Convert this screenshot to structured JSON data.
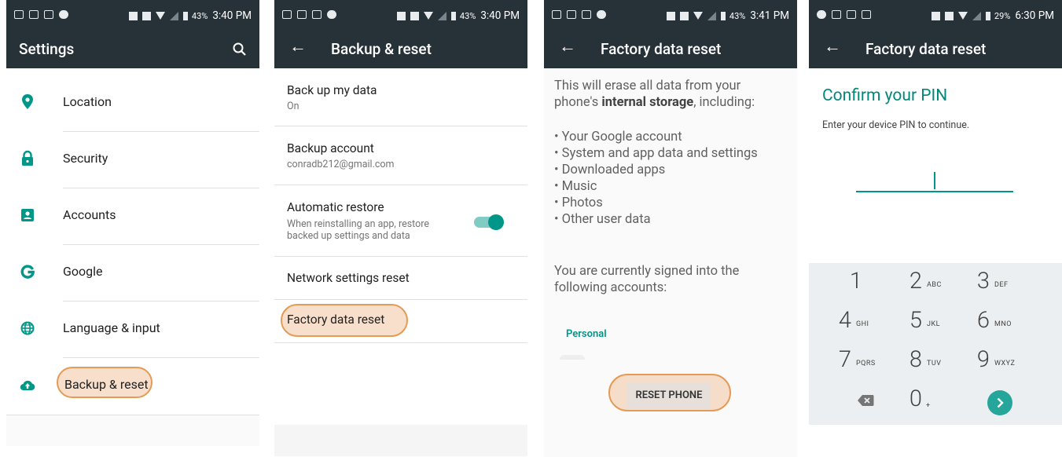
{
  "status_bars": [
    {
      "battery": "43%",
      "time": "3:40 PM"
    },
    {
      "battery": "43%",
      "time": "3:40 PM"
    },
    {
      "battery": "43%",
      "time": "3:41 PM"
    },
    {
      "battery": "29%",
      "time": "6:30 PM"
    }
  ],
  "screen1": {
    "title": "Settings",
    "items": [
      {
        "label": "Location",
        "icon": "location-pin-icon"
      },
      {
        "label": "Security",
        "icon": "lock-icon"
      },
      {
        "label": "Accounts",
        "icon": "account-icon"
      },
      {
        "label": "Google",
        "icon": "google-g-icon"
      },
      {
        "label": "Language & input",
        "icon": "globe-icon"
      },
      {
        "label": "Backup & reset",
        "icon": "cloud-upload-icon"
      }
    ],
    "highlighted": "Backup & reset"
  },
  "screen2": {
    "title": "Backup & reset",
    "items": [
      {
        "title": "Back up my data",
        "subtitle": "On"
      },
      {
        "title": "Backup account",
        "subtitle": "conradb212@gmail.com"
      },
      {
        "title": "Automatic restore",
        "subtitle_line1": "When reinstalling an app, restore",
        "subtitle_line2": "backed up settings and data",
        "toggle": "on"
      },
      {
        "title": "Network settings reset"
      },
      {
        "title": "Factory data reset"
      }
    ],
    "highlighted": "Factory data reset"
  },
  "screen3": {
    "title": "Factory data reset",
    "intro_line1": "This will erase all data from your",
    "intro_line2_prefix": "phone's ",
    "intro_line2_bold": "internal storage",
    "intro_line2_suffix": ", including:",
    "bullets": [
      "• Your Google account",
      "• System and app data and settings",
      "• Downloaded apps",
      "• Music",
      "• Photos",
      "• Other user data"
    ],
    "signed_in_line1": "You are currently signed into the",
    "signed_in_line2": "following accounts:",
    "personal_label": "Personal",
    "reset_button": "RESET PHONE"
  },
  "screen4": {
    "title": "Factory data reset",
    "heading": "Confirm your PIN",
    "subtitle": "Enter your device PIN to continue.",
    "keys": [
      {
        "digit": "1",
        "letters": ""
      },
      {
        "digit": "2",
        "letters": "ABC"
      },
      {
        "digit": "3",
        "letters": "DEF"
      },
      {
        "digit": "4",
        "letters": "GHI"
      },
      {
        "digit": "5",
        "letters": "JKL"
      },
      {
        "digit": "6",
        "letters": "MNO"
      },
      {
        "digit": "7",
        "letters": "PQRS"
      },
      {
        "digit": "8",
        "letters": "TUV"
      },
      {
        "digit": "9",
        "letters": "WXYZ"
      }
    ],
    "zero_digit": "0",
    "zero_letters": "+"
  },
  "colors": {
    "appbar": "#263238",
    "accent": "#009688",
    "highlight_border": "#e59a55",
    "highlight_fill": "#f2c4a0"
  }
}
